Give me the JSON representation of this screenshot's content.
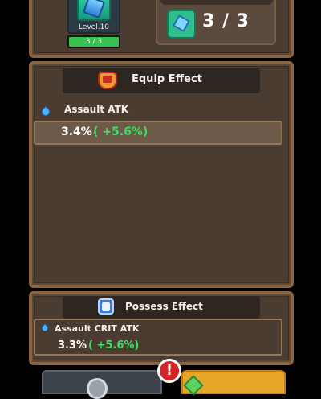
{
  "card": {
    "level_text": "Level.10",
    "progress_text": "3 / 3",
    "progress_fraction": 1.0
  },
  "count": {
    "text": "3 / 3"
  },
  "equip_effect": {
    "title": "Equip Effect",
    "stat_name": "Assault ATK",
    "value": "3.4%",
    "bonus": "( +5.6%)"
  },
  "possess_effect": {
    "title": "Possess Effect",
    "stat_name": "Assault CRIT ATK",
    "value": "3.3%",
    "bonus": "( +5.6%)"
  },
  "alert_badge": {
    "text": "!"
  },
  "colors": {
    "panel_bg": "#4a3c31",
    "panel_border": "#8a6441",
    "bonus_green": "#38e060",
    "progress_green": "#35c24e",
    "alert_red": "#d42525",
    "button_gold": "#e6a628"
  },
  "icons": {
    "card": "blue-gem-card-icon",
    "count": "gem-icon",
    "equip_header": "medal-icon",
    "possess_header": "blue-shield-icon",
    "stat": "water-drop-icon",
    "left_button": "gear-icon",
    "right_button": "green-gem-icon"
  }
}
